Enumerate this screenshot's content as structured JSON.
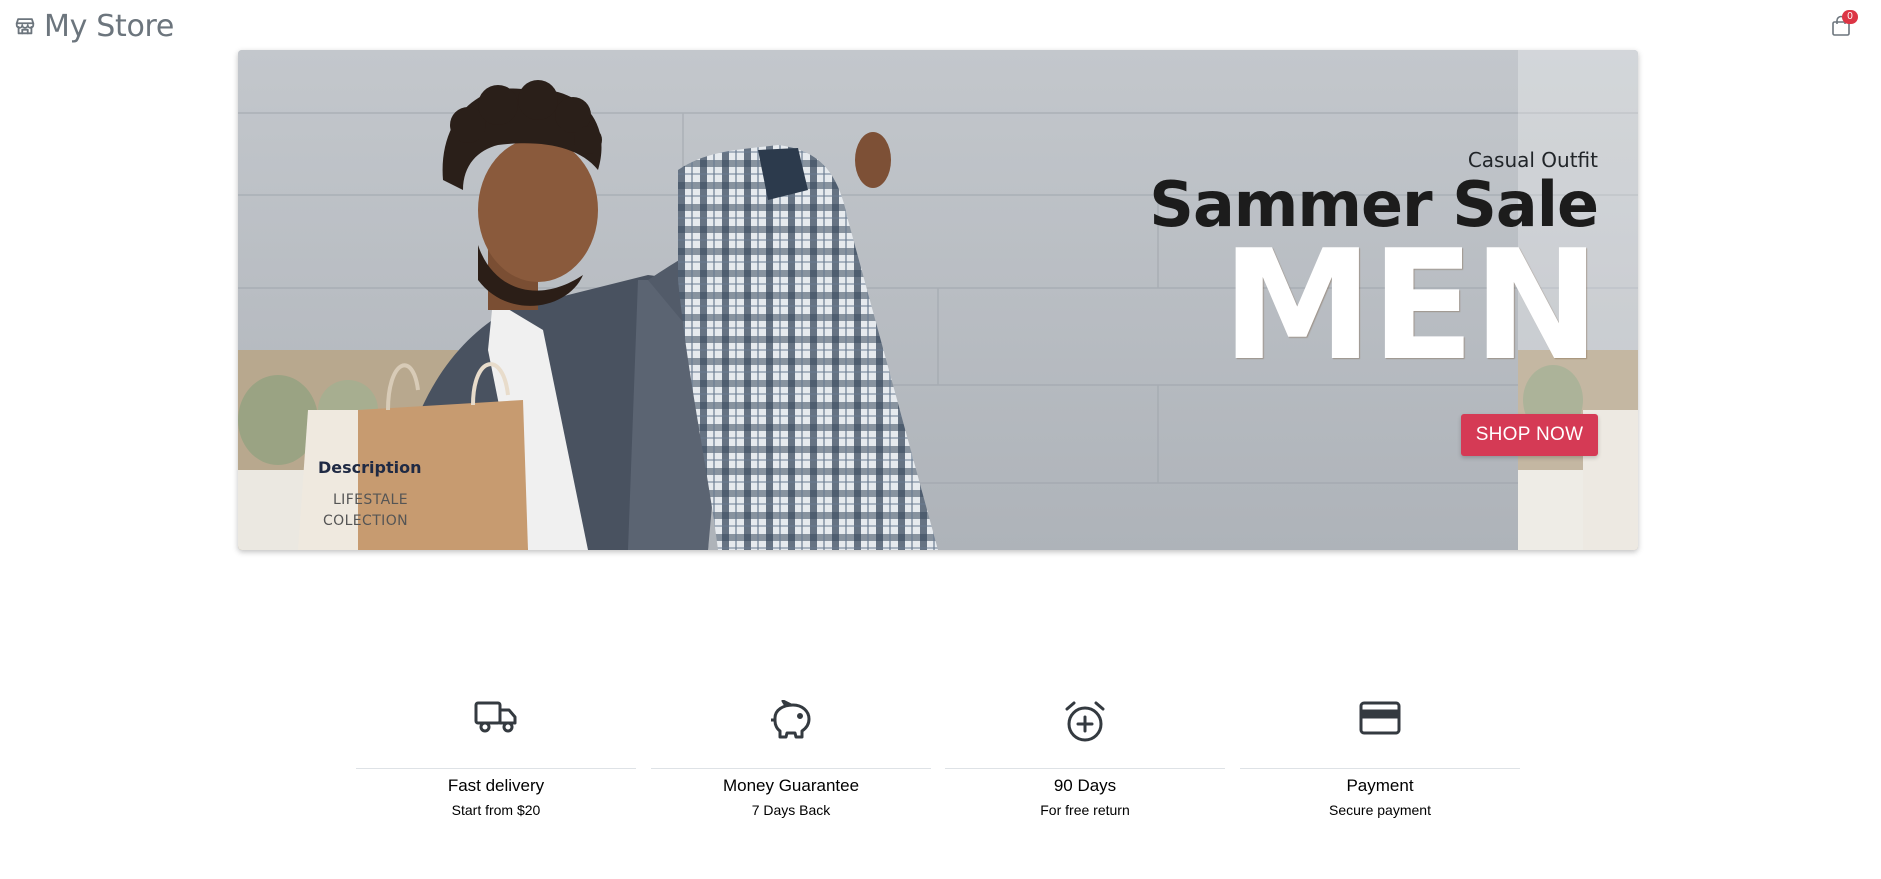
{
  "header": {
    "brand": "My Store",
    "brand_icon": "store-icon",
    "cart_icon": "shopping-bag-icon",
    "cart_count": "0"
  },
  "hero": {
    "subtitle": "Casual Outfit",
    "title": "Sammer Sale",
    "big_text": "MEN",
    "cta_label": "SHOP NOW",
    "cta_color": "#d53a55",
    "description_title": "Description",
    "description_text": "LIFESTALE COLECTION"
  },
  "features": [
    {
      "icon": "truck-icon",
      "title": "Fast delivery",
      "subtitle": "Start from $20"
    },
    {
      "icon": "piggy-bank-icon",
      "title": "Money Guarantee",
      "subtitle": "7 Days Back"
    },
    {
      "icon": "alarm-add-icon",
      "title": "90 Days",
      "subtitle": "For free return"
    },
    {
      "icon": "credit-card-icon",
      "title": "Payment",
      "subtitle": "Secure payment"
    }
  ]
}
